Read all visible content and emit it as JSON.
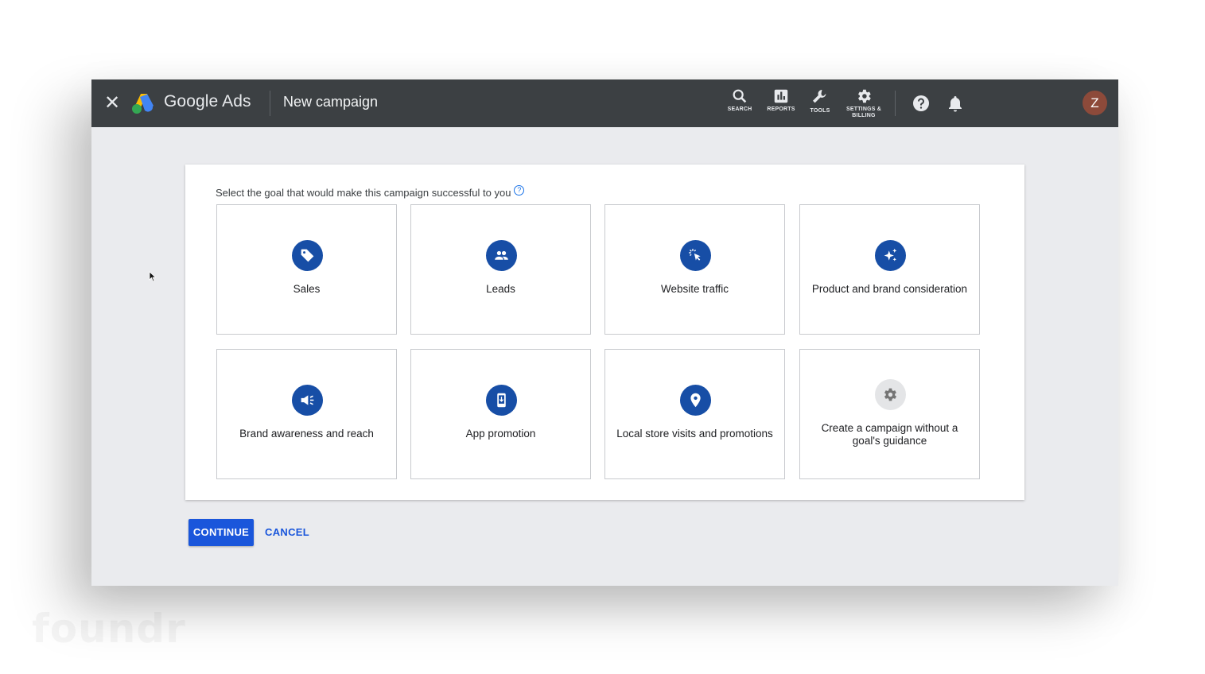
{
  "header": {
    "brand": "Google Ads",
    "page_title": "New campaign",
    "tools": [
      {
        "label": "SEARCH",
        "icon": "search-icon"
      },
      {
        "label": "REPORTS",
        "icon": "reports-icon"
      },
      {
        "label": "TOOLS",
        "icon": "wrench-icon"
      },
      {
        "label": "SETTINGS &",
        "label2": "BILLING",
        "icon": "gear-icon"
      }
    ],
    "avatar_initial": "Z",
    "brand_colors": {
      "blue": "#4285f4",
      "yellow": "#fbbc04",
      "green": "#34a853"
    }
  },
  "main": {
    "prompt": "Select the goal that would make this campaign successful to you",
    "help_glyph": "?",
    "goals": [
      {
        "label": "Sales",
        "icon": "tag-icon"
      },
      {
        "label": "Leads",
        "icon": "people-icon"
      },
      {
        "label": "Website traffic",
        "icon": "click-icon"
      },
      {
        "label": "Product and brand consideration",
        "icon": "sparkle-icon"
      },
      {
        "label": "Brand awareness and reach",
        "icon": "megaphone-icon"
      },
      {
        "label": "App promotion",
        "icon": "phone-download-icon"
      },
      {
        "label": "Local store visits and promotions",
        "icon": "location-pin-icon"
      },
      {
        "label": "Create a campaign without a goal's guidance",
        "icon": "gear-icon"
      }
    ],
    "goal_icon_color": "#174ea6"
  },
  "actions": {
    "continue_label": "CONTINUE",
    "cancel_label": "CANCEL",
    "accent": "#1a56db"
  },
  "watermark": "foundr"
}
